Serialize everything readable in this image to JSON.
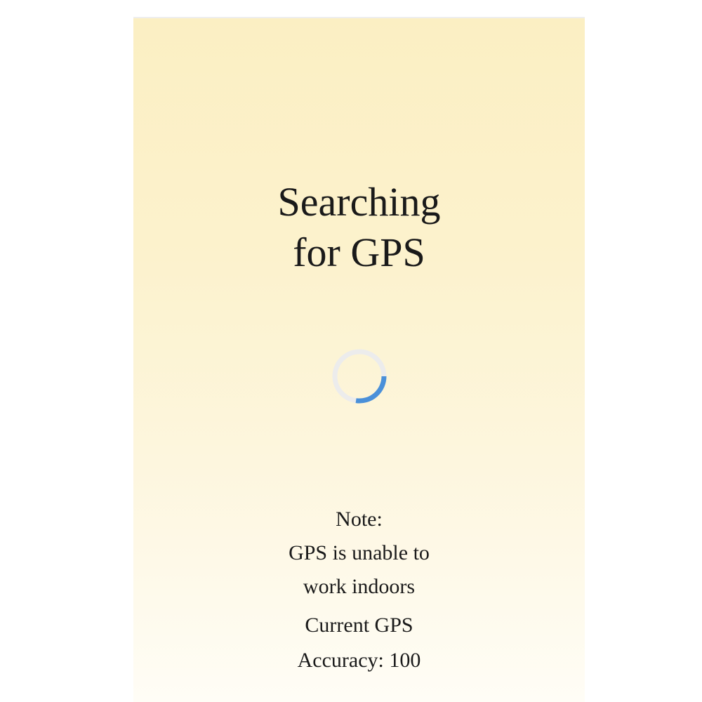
{
  "status": {
    "title_line1": "Searching",
    "title_line2": "for GPS"
  },
  "spinner": {
    "icon": "loading-spinner-icon",
    "track_color": "#ececec",
    "arc_color": "#4a90d9"
  },
  "note": {
    "heading": "Note:",
    "line1": "GPS is unable to",
    "line2": "work indoors"
  },
  "accuracy": {
    "line1": "Current GPS",
    "label": "Accuracy:",
    "value": "100"
  },
  "colors": {
    "background_top": "#fbefc3",
    "background_bottom": "#fffdf6",
    "text": "#1a1a1a"
  }
}
